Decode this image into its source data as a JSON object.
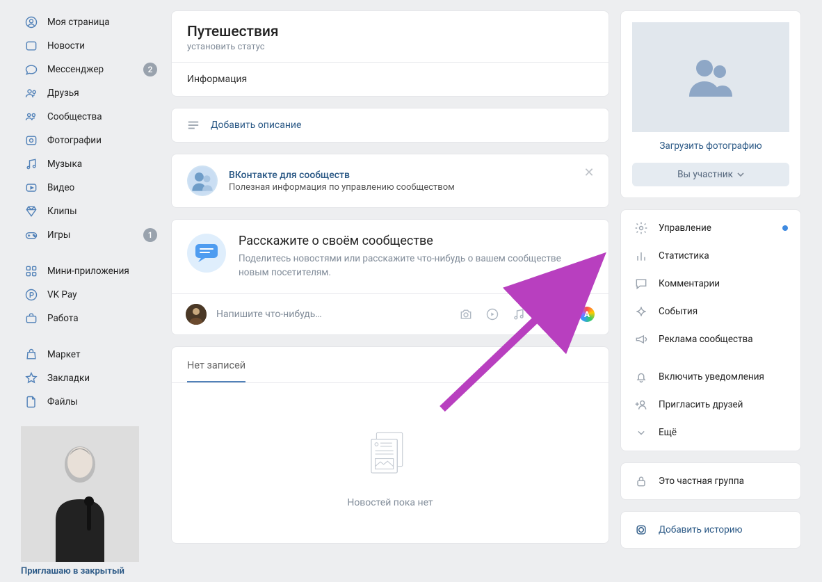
{
  "nav": {
    "items": [
      {
        "label": "Моя страница"
      },
      {
        "label": "Новости"
      },
      {
        "label": "Мессенджер",
        "badge": "2"
      },
      {
        "label": "Друзья"
      },
      {
        "label": "Сообщества"
      },
      {
        "label": "Фотографии"
      },
      {
        "label": "Музыка"
      },
      {
        "label": "Видео"
      },
      {
        "label": "Клипы"
      },
      {
        "label": "Игры",
        "badge": "1"
      },
      {
        "label": "Мини-приложения"
      },
      {
        "label": "VK Pay"
      },
      {
        "label": "Работа"
      },
      {
        "label": "Маркет"
      },
      {
        "label": "Закладки"
      },
      {
        "label": "Файлы"
      }
    ],
    "promo_caption": "Приглашаю в закрытый"
  },
  "header": {
    "title": "Путешествия",
    "status": "установить статус",
    "info": "Информация",
    "add_desc": "Добавить описание"
  },
  "vkapp": {
    "title": "ВКонтакте для сообществ",
    "subtitle": "Полезная информация по управлению сообществом"
  },
  "tell": {
    "title": "Расскажите о своём сообществе",
    "subtitle": "Поделитесь новостями или расскажите что-нибудь о вашем сообществе новым посетителям."
  },
  "compose": {
    "placeholder": "Напишите что-нибудь…"
  },
  "wall": {
    "tab": "Нет записей",
    "empty": "Новостей пока нет"
  },
  "cover": {
    "upload": "Загрузить фотографию",
    "member": "Вы участник"
  },
  "mgmt": {
    "items": [
      {
        "label": "Управление",
        "dot": true
      },
      {
        "label": "Статистика"
      },
      {
        "label": "Комментарии"
      },
      {
        "label": "События"
      },
      {
        "label": "Реклама сообщества"
      },
      {
        "label": "Включить уведомления"
      },
      {
        "label": "Пригласить друзей"
      },
      {
        "label": "Ещё"
      }
    ]
  },
  "privacy": {
    "label": "Это частная группа"
  },
  "story": {
    "label": "Добавить историю"
  }
}
